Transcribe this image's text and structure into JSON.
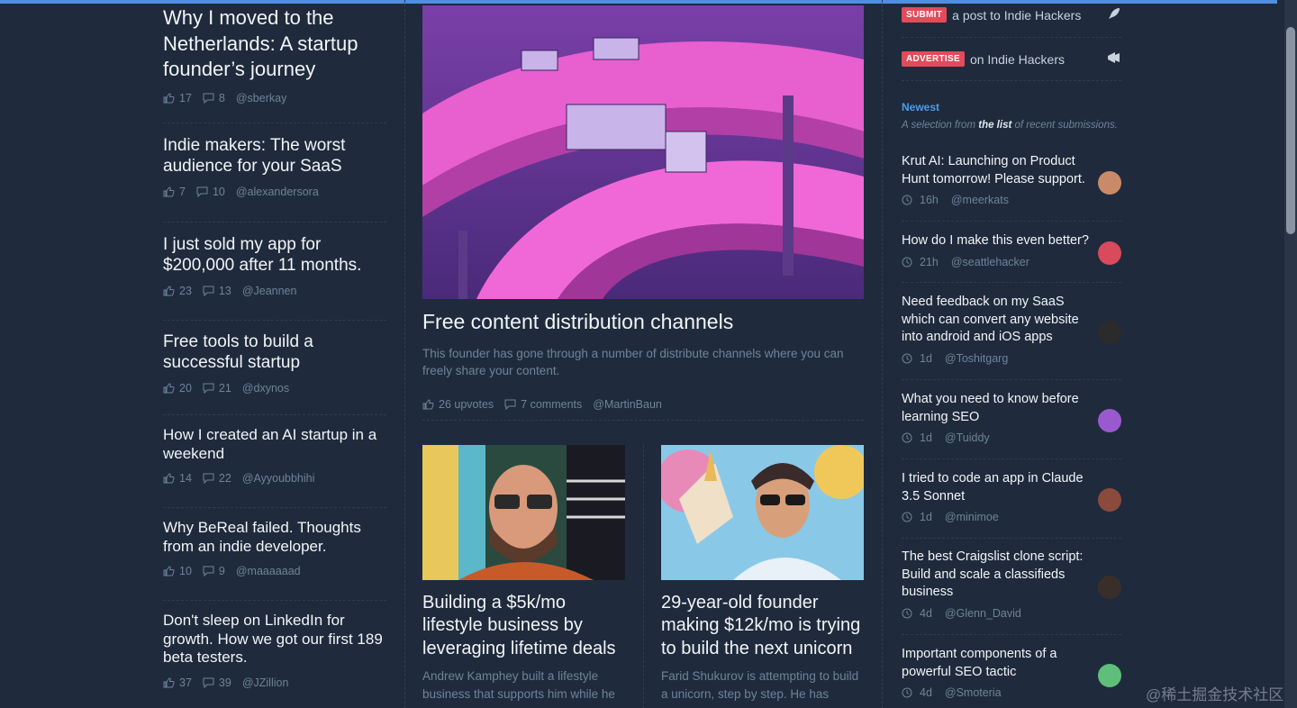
{
  "left_posts": [
    {
      "title": "Why I moved to the Netherlands: A startup founder’s journey",
      "upvotes": "17",
      "comments": "8",
      "author": "@sberkay"
    },
    {
      "title": "Indie makers: The worst audience for your SaaS",
      "upvotes": "7",
      "comments": "10",
      "author": "@alexandersora"
    },
    {
      "title": "I just sold my app for $200,000 after 11 months.",
      "upvotes": "23",
      "comments": "13",
      "author": "@Jeannen"
    },
    {
      "title": "Free tools to build a successful startup",
      "upvotes": "20",
      "comments": "21",
      "author": "@dxynos"
    },
    {
      "title": "How I created an AI startup in a weekend",
      "upvotes": "14",
      "comments": "22",
      "author": "@Ayyoubbhihi"
    },
    {
      "title": "Why BeReal failed. Thoughts from an indie developer.",
      "upvotes": "10",
      "comments": "9",
      "author": "@maaaaaad"
    },
    {
      "title": "Don't sleep on LinkedIn for growth. How we got our first 189 beta testers.",
      "upvotes": "37",
      "comments": "39",
      "author": "@JZillion"
    }
  ],
  "featured": {
    "title": "Free content distribution channels",
    "description": "This founder has gone through a number of distribute channels where you can freely share your content.",
    "upvotes": "26 upvotes",
    "comments": "7 comments",
    "author": "@MartinBaun"
  },
  "cards": [
    {
      "title": "Building a $5k/mo lifestyle business by leveraging lifetime deals",
      "description": "Andrew Kamphey built a lifestyle business that supports him while he"
    },
    {
      "title": "29-year-old founder making $12k/mo is trying to build the next unicorn",
      "description": "Farid Shukurov is attempting to build a unicorn, step by step. He has"
    }
  ],
  "sidebar": {
    "submit_badge": "SUBMIT",
    "submit_text": "a post to Indie Hackers",
    "advertise_badge": "ADVERTISE",
    "advertise_text": "on Indie Hackers",
    "newest_label": "Newest",
    "selection_prefix": "A selection from",
    "selection_link": "the list",
    "selection_suffix": "of recent submissions.",
    "items": [
      {
        "title": "Krut AI: Launching on Product Hunt tomorrow! Please support.",
        "time": "16h",
        "author": "@meerkats",
        "avatar_color": "#c98a6a"
      },
      {
        "title": "How do I make this even better?",
        "time": "21h",
        "author": "@seattlehacker",
        "avatar_color": "#d84a5c"
      },
      {
        "title": "Need feedback on my SaaS which can convert any website into android and iOS apps",
        "time": "1d",
        "author": "@Toshitgarg",
        "avatar_color": "#2b2b2b"
      },
      {
        "title": "What you need to know before learning SEO",
        "time": "1d",
        "author": "@Tuiddy",
        "avatar_color": "#9b59d0"
      },
      {
        "title": "I tried to code an app in Claude 3.5 Sonnet",
        "time": "1d",
        "author": "@minimoe",
        "avatar_color": "#8a4b3c"
      },
      {
        "title": "The best Craigslist clone script: Build and scale a classifieds business",
        "time": "4d",
        "author": "@Glenn_David",
        "avatar_color": "#3a2e2a"
      },
      {
        "title": "Important components of a powerful SEO tactic",
        "time": "4d",
        "author": "@Smoteria",
        "avatar_color": "#5fbf7a"
      }
    ]
  },
  "watermark": "@稀土掘金技术社区",
  "colors": {
    "background": "#1f2b3c",
    "accent": "#4f9ae8",
    "badge": "#e14b5a",
    "muted": "#6f829b"
  }
}
